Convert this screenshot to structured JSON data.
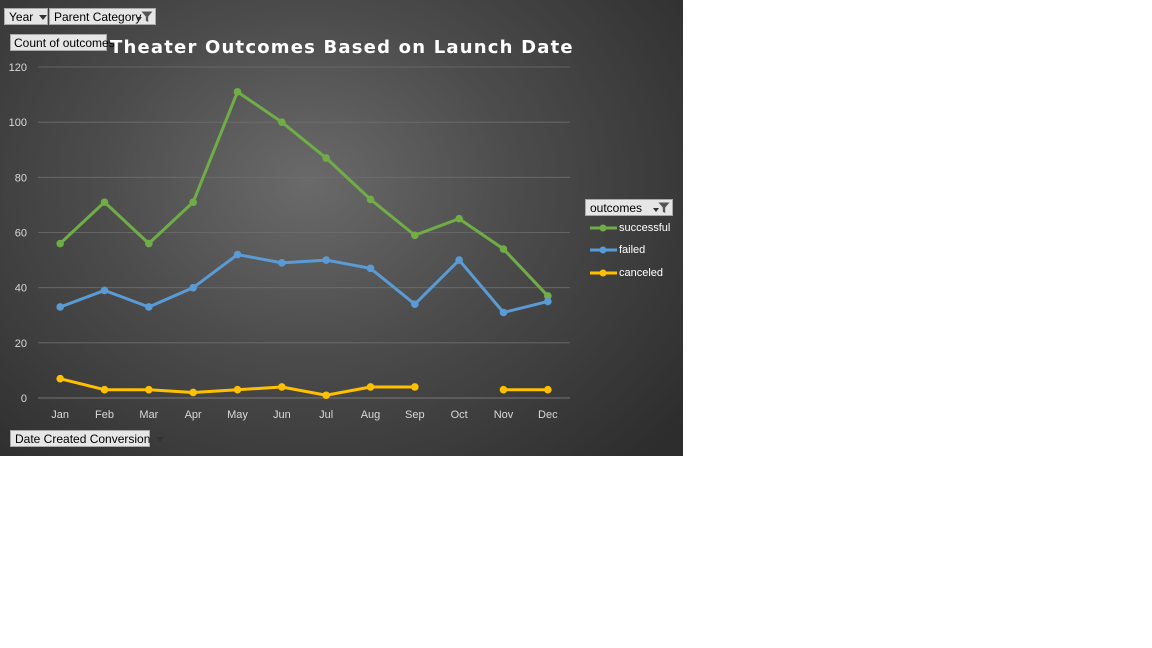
{
  "filters": {
    "year_label": "Year",
    "parent_category_label": "Parent Category",
    "value_field_label": "Count of outcomes",
    "axis_field_label": "Date Created Conversion",
    "legend_field_label": "outcomes"
  },
  "colors": {
    "successful": "#70ad47",
    "failed": "#5b9bd5",
    "canceled": "#ffc000"
  },
  "chart_data": {
    "type": "line",
    "title": "Theater Outcomes Based on Launch Date",
    "xlabel": "",
    "ylabel": "",
    "categories": [
      "Jan",
      "Feb",
      "Mar",
      "Apr",
      "May",
      "Jun",
      "Jul",
      "Aug",
      "Sep",
      "Oct",
      "Nov",
      "Dec"
    ],
    "ylim": [
      0,
      120
    ],
    "yticks": [
      0,
      20,
      40,
      60,
      80,
      100,
      120
    ],
    "grid": true,
    "legend_position": "right",
    "series": [
      {
        "name": "successful",
        "values": [
          56,
          71,
          56,
          71,
          111,
          100,
          87,
          72,
          59,
          65,
          54,
          37
        ]
      },
      {
        "name": "failed",
        "values": [
          33,
          39,
          33,
          40,
          52,
          49,
          50,
          47,
          34,
          50,
          31,
          35
        ]
      },
      {
        "name": "canceled",
        "values": [
          7,
          3,
          3,
          2,
          3,
          4,
          1,
          4,
          4,
          null,
          3,
          3
        ]
      }
    ]
  }
}
